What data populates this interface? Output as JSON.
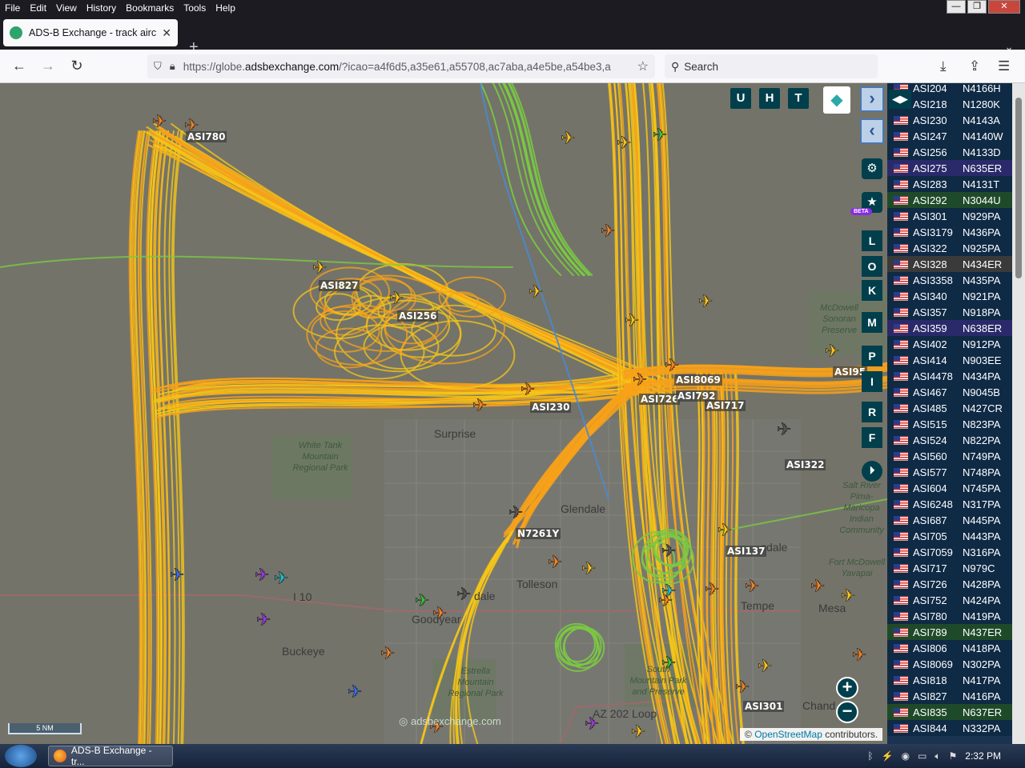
{
  "menu": [
    "File",
    "Edit",
    "View",
    "History",
    "Bookmarks",
    "Tools",
    "Help"
  ],
  "window_controls": {
    "minimize": "—",
    "maximize": "❐",
    "close": "✕"
  },
  "tab": {
    "title": "ADS-B Exchange - track aircraft",
    "close": "✕"
  },
  "newtab": "+",
  "tablist": "⌄",
  "nav": {
    "back": "←",
    "forward": "→",
    "reload": "↻",
    "url_prefix": "https://globe.",
    "url_domain": "adsbexchange.com",
    "url_rest": "/?icao=a4f6d5,a35e61,a55708,ac7aba,a4e5be,a54be3,a",
    "search_placeholder": "Search",
    "download": "⤓",
    "extensions": "⇪",
    "menu": "☰"
  },
  "map": {
    "top_buttons": [
      "U",
      "H",
      "T"
    ],
    "side_buttons": [
      "L",
      "O",
      "K",
      "M",
      "P",
      "I",
      "R",
      "F"
    ],
    "beta": "BETA",
    "zoom_in": "+",
    "zoom_out": "−",
    "scale": "5 NM",
    "watermark": "adsbexchange.com",
    "attribution_prefix": "©",
    "attribution_link": "OpenStreetMap",
    "attribution_suffix": " contributors.",
    "places": [
      {
        "name": "Surprise",
        "italic": false
      },
      {
        "name": "Glendale",
        "italic": false
      },
      {
        "name": "Tolleson",
        "italic": false
      },
      {
        "name": "Buckeye",
        "italic": false
      },
      {
        "name": "Goodyear",
        "italic": false
      },
      {
        "name": "dale",
        "italic": false
      },
      {
        "name": "Tempe",
        "italic": false
      },
      {
        "name": "Mesa",
        "italic": false
      },
      {
        "name": "Chand",
        "italic": false
      },
      {
        "name": "sdale",
        "italic": false
      },
      {
        "name": "I 10",
        "italic": false
      },
      {
        "name": "AZ 202 Loop",
        "italic": false
      },
      {
        "name": "White Tank Mountain Regional Park",
        "italic": true
      },
      {
        "name": "Estrella Mountain Regional Park",
        "italic": true
      },
      {
        "name": "South Mountain Park and Preserve",
        "italic": true
      },
      {
        "name": "McDowell Sonoran Preserve",
        "italic": true
      },
      {
        "name": "Salt River Pima-Maricopa Indian Community",
        "italic": true
      },
      {
        "name": "Fort McDowell Yavapai",
        "italic": true
      }
    ],
    "labels": [
      "ASI780",
      "ASI827",
      "ASI256",
      "ASI230",
      "ASI8069",
      "ASI726",
      "ASI792",
      "ASI717",
      "ASI322",
      "N7261Y",
      "ASI137",
      "ASI301",
      "ASI95"
    ]
  },
  "aircraft_list": [
    {
      "callsign": "ASI204",
      "reg": "N4166H",
      "hl": ""
    },
    {
      "callsign": "ASI218",
      "reg": "N1280K",
      "hl": ""
    },
    {
      "callsign": "ASI230",
      "reg": "N4143A",
      "hl": ""
    },
    {
      "callsign": "ASI247",
      "reg": "N4140W",
      "hl": ""
    },
    {
      "callsign": "ASI256",
      "reg": "N4133D",
      "hl": ""
    },
    {
      "callsign": "ASI275",
      "reg": "N635ER",
      "hl": "purple"
    },
    {
      "callsign": "ASI283",
      "reg": "N4131T",
      "hl": ""
    },
    {
      "callsign": "ASI292",
      "reg": "N3044U",
      "hl": "green"
    },
    {
      "callsign": "ASI301",
      "reg": "N929PA",
      "hl": ""
    },
    {
      "callsign": "ASI3179",
      "reg": "N436PA",
      "hl": ""
    },
    {
      "callsign": "ASI322",
      "reg": "N925PA",
      "hl": ""
    },
    {
      "callsign": "ASI328",
      "reg": "N434ER",
      "hl": "grey"
    },
    {
      "callsign": "ASI3358",
      "reg": "N435PA",
      "hl": ""
    },
    {
      "callsign": "ASI340",
      "reg": "N921PA",
      "hl": ""
    },
    {
      "callsign": "ASI357",
      "reg": "N918PA",
      "hl": ""
    },
    {
      "callsign": "ASI359",
      "reg": "N638ER",
      "hl": "purple"
    },
    {
      "callsign": "ASI402",
      "reg": "N912PA",
      "hl": ""
    },
    {
      "callsign": "ASI414",
      "reg": "N903EE",
      "hl": ""
    },
    {
      "callsign": "ASI4478",
      "reg": "N434PA",
      "hl": ""
    },
    {
      "callsign": "ASI467",
      "reg": "N9045B",
      "hl": ""
    },
    {
      "callsign": "ASI485",
      "reg": "N427CR",
      "hl": ""
    },
    {
      "callsign": "ASI515",
      "reg": "N823PA",
      "hl": ""
    },
    {
      "callsign": "ASI524",
      "reg": "N822PA",
      "hl": ""
    },
    {
      "callsign": "ASI560",
      "reg": "N749PA",
      "hl": ""
    },
    {
      "callsign": "ASI577",
      "reg": "N748PA",
      "hl": ""
    },
    {
      "callsign": "ASI604",
      "reg": "N745PA",
      "hl": ""
    },
    {
      "callsign": "ASI6248",
      "reg": "N317PA",
      "hl": ""
    },
    {
      "callsign": "ASI687",
      "reg": "N445PA",
      "hl": ""
    },
    {
      "callsign": "ASI705",
      "reg": "N443PA",
      "hl": ""
    },
    {
      "callsign": "ASI7059",
      "reg": "N316PA",
      "hl": ""
    },
    {
      "callsign": "ASI717",
      "reg": "N979C",
      "hl": ""
    },
    {
      "callsign": "ASI726",
      "reg": "N428PA",
      "hl": ""
    },
    {
      "callsign": "ASI752",
      "reg": "N424PA",
      "hl": ""
    },
    {
      "callsign": "ASI780",
      "reg": "N419PA",
      "hl": ""
    },
    {
      "callsign": "ASI789",
      "reg": "N437ER",
      "hl": "green"
    },
    {
      "callsign": "ASI806",
      "reg": "N418PA",
      "hl": ""
    },
    {
      "callsign": "ASI8069",
      "reg": "N302PA",
      "hl": ""
    },
    {
      "callsign": "ASI818",
      "reg": "N417PA",
      "hl": ""
    },
    {
      "callsign": "ASI827",
      "reg": "N416PA",
      "hl": ""
    },
    {
      "callsign": "ASI835",
      "reg": "N637ER",
      "hl": "green"
    },
    {
      "callsign": "ASI844",
      "reg": "N332PA",
      "hl": ""
    }
  ],
  "taskbar": {
    "item": "ADS-B Exchange - tr...",
    "time": "2:32 PM"
  },
  "colors": {
    "track_orange": "#f7a11a",
    "track_yellow": "#f5c518",
    "track_green": "#7ac943",
    "panel_bg": "#0f2a45",
    "button_bg": "#003f4b"
  }
}
